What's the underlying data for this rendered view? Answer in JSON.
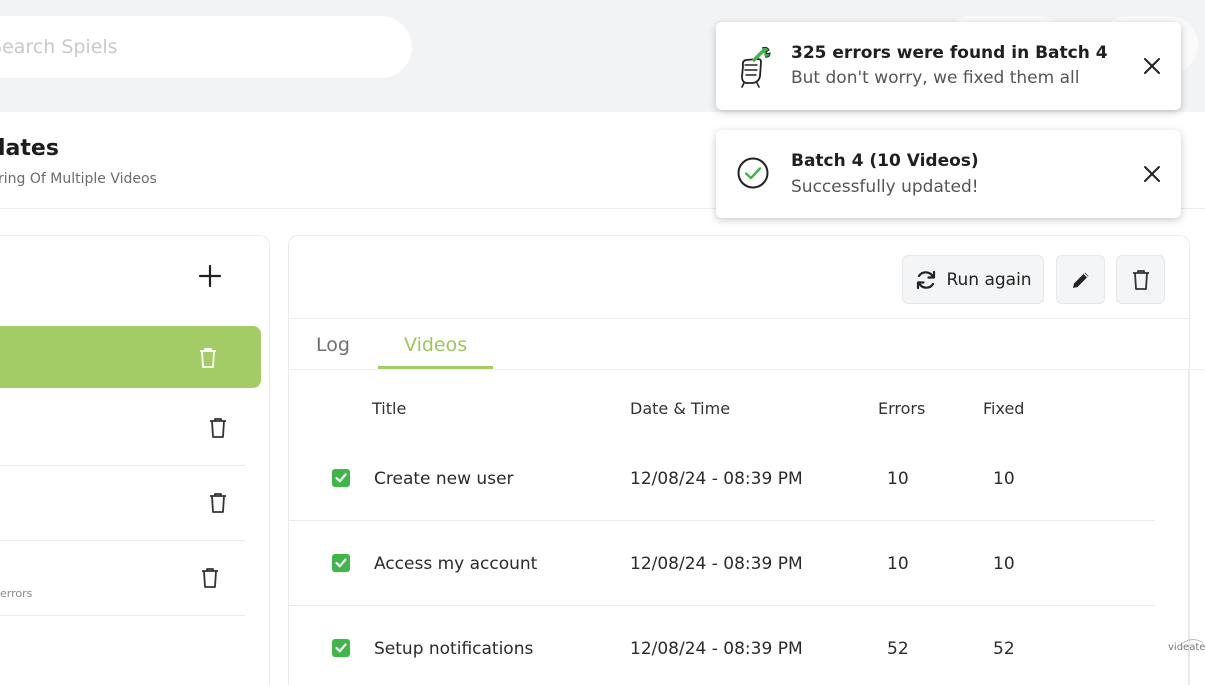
{
  "search": {
    "placeholder": "Search Spiels"
  },
  "header": {
    "title": "lates",
    "subtitle": "ring Of Multiple Videos"
  },
  "batches": {
    "row3_errors": "errors"
  },
  "toolbar": {
    "run_again_label": "Run again"
  },
  "tabs": [
    {
      "label": "Log",
      "active": false
    },
    {
      "label": "Videos",
      "active": true
    }
  ],
  "table": {
    "columns": [
      "Title",
      "Date & Time",
      "Errors",
      "Fixed"
    ],
    "rows": [
      {
        "checked": true,
        "title": "Create new user",
        "datetime": "12/08/24 - 08:39 PM",
        "errors": "10",
        "fixed": "10"
      },
      {
        "checked": true,
        "title": "Access my account",
        "datetime": "12/08/24 - 08:39 PM",
        "errors": "10",
        "fixed": "10"
      },
      {
        "checked": true,
        "title": "Setup notifications",
        "datetime": "12/08/24 - 08:39 PM",
        "errors": "52",
        "fixed": "52"
      }
    ]
  },
  "toasts": [
    {
      "icon": "fist-wrench-icon",
      "title": "325 errors were found in Batch 4",
      "message": "But don't worry, we fixed them all"
    },
    {
      "icon": "check-circle-icon",
      "title": "Batch 4 (10 Videos)",
      "message": "Successfully updated!"
    }
  ],
  "watermark": "videate",
  "colors": {
    "accent": "#a3cc66",
    "tab_active": "#9bc75a",
    "checkbox": "#3fb54a",
    "topbar": "#f2f3f4"
  }
}
